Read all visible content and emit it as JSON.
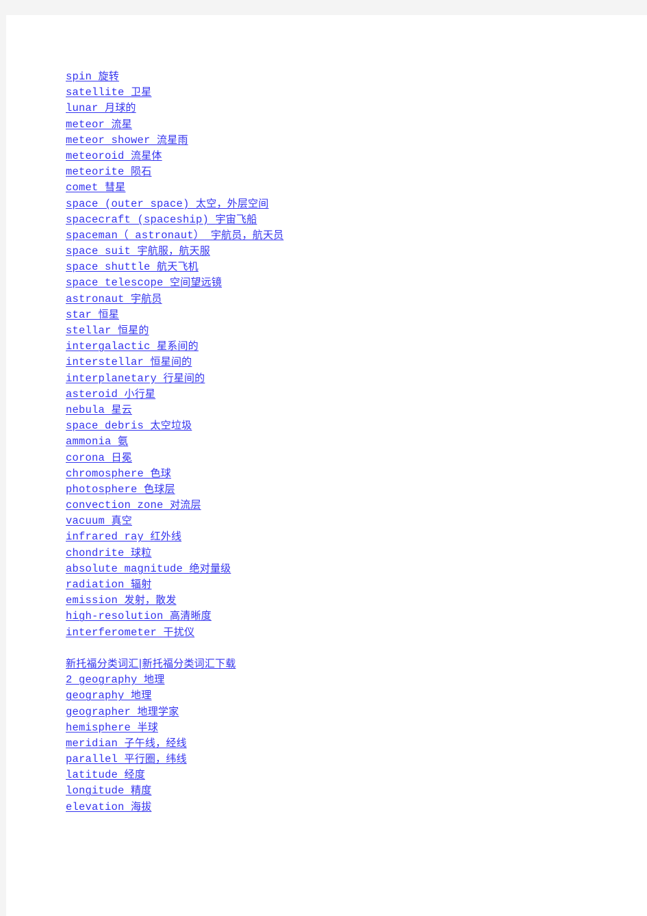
{
  "page": {
    "background_color": "#f4f4f4",
    "paper_color": "#ffffff",
    "link_color": "#3333ee"
  },
  "lines": [
    {
      "en": "spin",
      "cn": "旋转"
    },
    {
      "en": "satellite",
      "cn": "卫星"
    },
    {
      "en": "lunar",
      "cn": "月球的"
    },
    {
      "en": "meteor",
      "cn": "流星"
    },
    {
      "en": "meteor shower",
      "cn": "流星雨"
    },
    {
      "en": "meteoroid",
      "cn": "流星体"
    },
    {
      "en": "meteorite",
      "cn": "陨石"
    },
    {
      "en": "comet",
      "cn": "彗星"
    },
    {
      "en": "space (outer space)",
      "cn": "太空，外层空间"
    },
    {
      "en": "spacecraft (spaceship)",
      "cn": "宇宙飞船"
    },
    {
      "en": "spaceman（ astronaut）",
      "cn": "宇航员，航天员"
    },
    {
      "en": "space suit",
      "cn": "宇航服，航天服"
    },
    {
      "en": "space shuttle",
      "cn": "航天飞机"
    },
    {
      "en": "space telescope",
      "cn": "空间望远镜"
    },
    {
      "en": "astronaut",
      "cn": "宇航员"
    },
    {
      "en": "star",
      "cn": "恒星"
    },
    {
      "en": "stellar",
      "cn": "恒星的"
    },
    {
      "en": "intergalactic",
      "cn": "星系间的"
    },
    {
      "en": "interstellar",
      "cn": "恒星间的"
    },
    {
      "en": "interplanetary",
      "cn": "行星间的"
    },
    {
      "en": "asteroid",
      "cn": "小行星"
    },
    {
      "en": "nebula",
      "cn": "星云"
    },
    {
      "en": "space debris",
      "cn": "太空垃圾"
    },
    {
      "en": "ammonia",
      "cn": "氨"
    },
    {
      "en": "corona",
      "cn": "日冕"
    },
    {
      "en": "chromosphere",
      "cn": "色球"
    },
    {
      "en": "photosphere",
      "cn": "色球层"
    },
    {
      "en": "convection zone",
      "cn": "对流层"
    },
    {
      "en": "vacuum",
      "cn": "真空"
    },
    {
      "en": "infrared ray",
      "cn": "红外线"
    },
    {
      "en": "chondrite",
      "cn": "球粒"
    },
    {
      "en": "absolute magnitude",
      "cn": "绝对量级"
    },
    {
      "en": "radiation",
      "cn": "辐射"
    },
    {
      "en": "emission",
      "cn": "发射，散发"
    },
    {
      "en": "high-resolution",
      "cn": "高清晰度"
    },
    {
      "en": "interferometer",
      "cn": "干扰仪"
    },
    {
      "blank": true
    },
    {
      "en": "",
      "cn": "新托福分类词汇|新托福分类词汇下载"
    },
    {
      "en": "2 geography",
      "cn": "地理"
    },
    {
      "en": "geography",
      "cn": "地理"
    },
    {
      "en": "geographer",
      "cn": "地理学家"
    },
    {
      "en": "hemisphere",
      "cn": "半球"
    },
    {
      "en": "meridian",
      "cn": "子午线，经线"
    },
    {
      "en": "parallel",
      "cn": "平行圈，纬线"
    },
    {
      "en": "latitude",
      "cn": "经度"
    },
    {
      "en": "longitude",
      "cn": "精度"
    },
    {
      "en": "elevation",
      "cn": "海拔"
    }
  ]
}
